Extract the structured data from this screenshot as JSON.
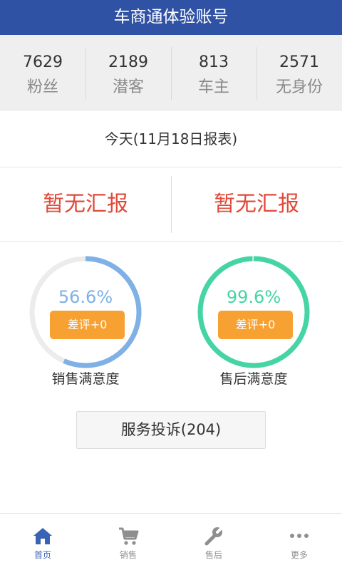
{
  "header": {
    "title": "车商通体验账号"
  },
  "stats": [
    {
      "value": "7629",
      "label": "粉丝"
    },
    {
      "value": "2189",
      "label": "潜客"
    },
    {
      "value": "813",
      "label": "车主"
    },
    {
      "value": "2571",
      "label": "无身份"
    }
  ],
  "report": {
    "title": "今天(11月18日报表)",
    "left": "暂无汇报",
    "right": "暂无汇报"
  },
  "satisfaction": [
    {
      "percent": "56.6%",
      "value": 0.566,
      "badge": "差评+0",
      "label": "销售满意度",
      "color": "#7fb0e6"
    },
    {
      "percent": "99.6%",
      "value": 0.996,
      "badge": "差评+0",
      "label": "售后满意度",
      "color": "#45d4a5"
    }
  ],
  "complaint": {
    "label": "服务投诉(204)"
  },
  "tabs": [
    {
      "label": "首页",
      "icon": "home-icon",
      "active": true
    },
    {
      "label": "销售",
      "icon": "cart-icon",
      "active": false
    },
    {
      "label": "售后",
      "icon": "wrench-icon",
      "active": false
    },
    {
      "label": "更多",
      "icon": "more-icon",
      "active": false
    }
  ],
  "colors": {
    "header": "#2f52a4",
    "accent_red": "#e04a3a",
    "badge": "#f7a133",
    "tab_active": "#3b63b5"
  }
}
